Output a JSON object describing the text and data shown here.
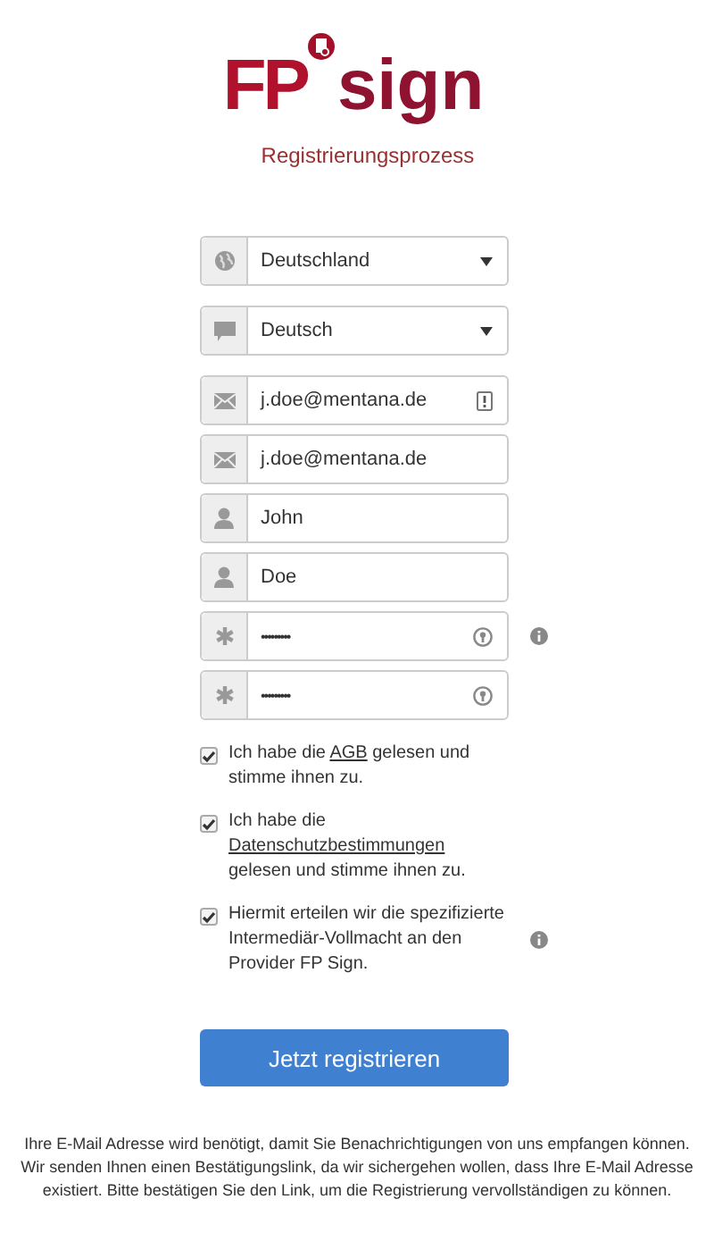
{
  "logo": {
    "brand": "FP",
    "product": "sign"
  },
  "subtitle": "Registrierungsprozess",
  "fields": [
    {
      "kind": "country",
      "value": "Deutschland",
      "flagged": false,
      "info": false
    },
    {
      "kind": "language",
      "value": "Deutsch",
      "flagged": false,
      "info": false
    },
    {
      "kind": "email",
      "value": "j.doe@mentana.de",
      "flagged": true,
      "info": false
    },
    {
      "kind": "email",
      "value": "j.doe@mentana.de",
      "flagged": false,
      "info": false
    },
    {
      "kind": "name",
      "value": "John",
      "flagged": false,
      "info": false
    },
    {
      "kind": "name",
      "value": "Doe",
      "flagged": false,
      "info": false
    },
    {
      "kind": "password",
      "value": "•••••••••",
      "flagged": false,
      "info": true
    },
    {
      "kind": "password",
      "value": "•••••••••",
      "flagged": false,
      "info": false
    }
  ],
  "agreements": [
    {
      "checked": true,
      "before": "Ich habe die",
      "link": "AGB",
      "after": "gelesen und stimme ihnen zu.",
      "info": false
    },
    {
      "checked": true,
      "before": "Ich habe die",
      "link": "Datenschutzbestimmungen",
      "after": "gelesen und stimme ihnen zu.",
      "info": false
    },
    {
      "checked": true,
      "before": "Hiermit erteilen wir die spezifizierte Intermediär-Vollmacht an den Provider FP Sign.",
      "info": true
    }
  ],
  "button": "Jetzt registrieren",
  "note": "Ihre E-Mail Adresse wird benötigt, damit Sie Benachrichtigungen von uns empfangen können. Wir senden Ihnen einen Bestätigungslink, da wir sichergehen wollen, dass Ihre E-Mail Adresse existiert. Bitte bestätigen Sie den Link, um die Registrierung vervollständigen zu können."
}
